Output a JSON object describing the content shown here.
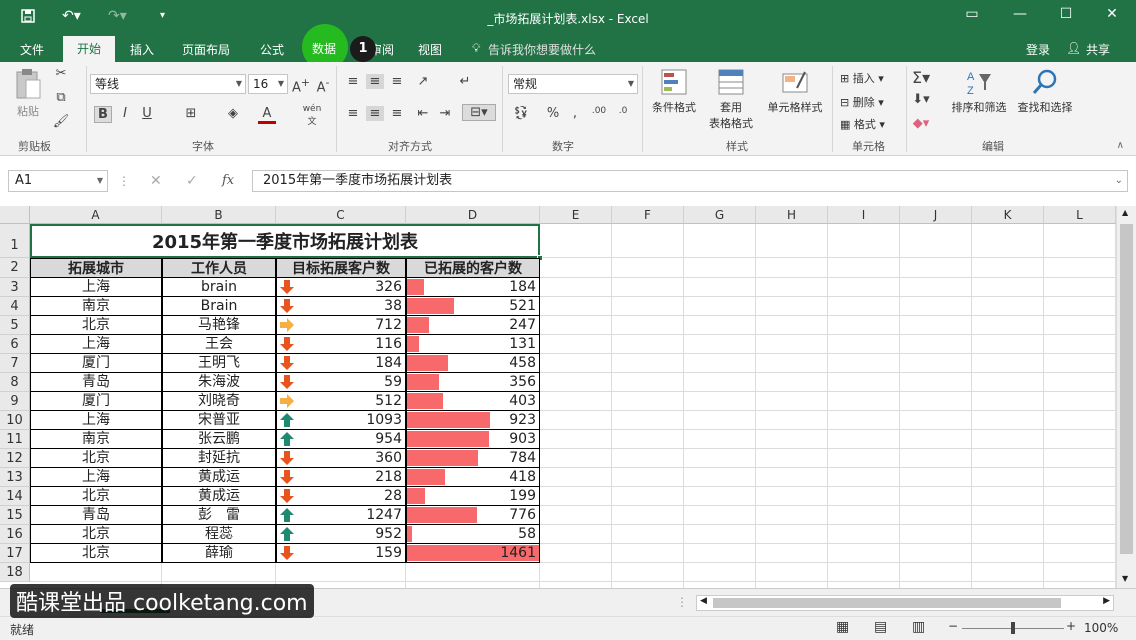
{
  "window": {
    "title": "_市场拓展计划表.xlsx - Excel",
    "qat": {
      "save_icon": "save-icon",
      "undo_icon": "undo-icon",
      "redo_icon": "redo-icon"
    },
    "controls": {
      "ribbon_display": "▭",
      "minimize": "—",
      "restore": "☐",
      "close": "✕"
    }
  },
  "menu": {
    "file": "文件",
    "home": "开始",
    "insert": "插入",
    "page_layout": "页面布局",
    "formulas": "公式",
    "data": "数据",
    "review": "审阅",
    "view": "视图",
    "tell_me": "告诉我你想要做什么",
    "sign_in": "登录",
    "share": "共享",
    "step_badge": "1"
  },
  "ribbon": {
    "clipboard": {
      "paste": "粘贴",
      "label": "剪贴板"
    },
    "font": {
      "name": "等线",
      "size": "16",
      "bold": "B",
      "italic": "I",
      "underline": "U",
      "label": "字体",
      "wen": "wén 文"
    },
    "alignment": {
      "label": "对齐方式"
    },
    "number": {
      "format": "常规",
      "label": "数字"
    },
    "styles": {
      "conditional": "条件格式",
      "table_format": "套用\n表格格式",
      "table_format_1": "套用",
      "table_format_2": "表格格式",
      "cell_styles": "单元格样式",
      "label": "样式"
    },
    "cells": {
      "insert": "插入",
      "delete": "删除",
      "format": "格式",
      "label": "单元格"
    },
    "editing": {
      "sort_filter": "排序和筛选",
      "find_select": "查找和选择",
      "label": "编辑"
    }
  },
  "formula_bar": {
    "name_box": "A1",
    "fx": "fx",
    "content": "2015年第一季度市场拓展计划表"
  },
  "grid": {
    "columns": [
      "A",
      "B",
      "C",
      "D",
      "E",
      "F",
      "G",
      "H",
      "I",
      "J",
      "K",
      "L"
    ],
    "row_numbers": [
      "1",
      "2",
      "3",
      "4",
      "5",
      "6",
      "7",
      "8",
      "9",
      "10",
      "11",
      "12",
      "13",
      "14",
      "15",
      "16",
      "17",
      "18"
    ],
    "title": "2015年第一季度市场拓展计划表",
    "headers": [
      "拓展城市",
      "工作人员",
      "目标拓展客户数",
      "已拓展的客户数"
    ],
    "rows": [
      {
        "city": "上海",
        "staff": "brain",
        "target": "326",
        "done": "184",
        "trend": "down",
        "bar": 184
      },
      {
        "city": "南京",
        "staff": "Brain",
        "target": "38",
        "done": "521",
        "trend": "down",
        "bar": 521
      },
      {
        "city": "北京",
        "staff": "马艳锋",
        "target": "712",
        "done": "247",
        "trend": "right",
        "bar": 247
      },
      {
        "city": "上海",
        "staff": "王会",
        "target": "116",
        "done": "131",
        "trend": "down",
        "bar": 131
      },
      {
        "city": "厦门",
        "staff": "王明飞",
        "target": "184",
        "done": "458",
        "trend": "down",
        "bar": 458
      },
      {
        "city": "青岛",
        "staff": "朱海波",
        "target": "59",
        "done": "356",
        "trend": "down",
        "bar": 356
      },
      {
        "city": "厦门",
        "staff": "刘晓奇",
        "target": "512",
        "done": "403",
        "trend": "right",
        "bar": 403
      },
      {
        "city": "上海",
        "staff": "宋普亚",
        "target": "1093",
        "done": "923",
        "trend": "up",
        "bar": 923
      },
      {
        "city": "南京",
        "staff": "张云鹏",
        "target": "954",
        "done": "903",
        "trend": "up",
        "bar": 903
      },
      {
        "city": "北京",
        "staff": "封延抗",
        "target": "360",
        "done": "784",
        "trend": "down",
        "bar": 784
      },
      {
        "city": "上海",
        "staff": "黄成运",
        "target": "218",
        "done": "418",
        "trend": "down",
        "bar": 418
      },
      {
        "city": "北京",
        "staff": "黄成运",
        "target": "28",
        "done": "199",
        "trend": "down",
        "bar": 199
      },
      {
        "city": "青岛",
        "staff": "彭　雷",
        "target": "1247",
        "done": "776",
        "trend": "up",
        "bar": 776
      },
      {
        "city": "北京",
        "staff": "程蕊",
        "target": "952",
        "done": "58",
        "trend": "up",
        "bar": 58
      },
      {
        "city": "北京",
        "staff": "薛瑜",
        "target": "159",
        "done": "1461",
        "trend": "down",
        "bar": 1461
      }
    ]
  },
  "status": {
    "ready": "就绪",
    "zoom": "100%",
    "zoom_level": 100
  },
  "watermark": "酷课堂出品 coolketang.com",
  "colors": {
    "excel_green": "#217346",
    "bar_red": "#f8696b",
    "arrow_down": "#e8541d",
    "arrow_up": "#1f8a70",
    "arrow_right": "#f5b041"
  }
}
